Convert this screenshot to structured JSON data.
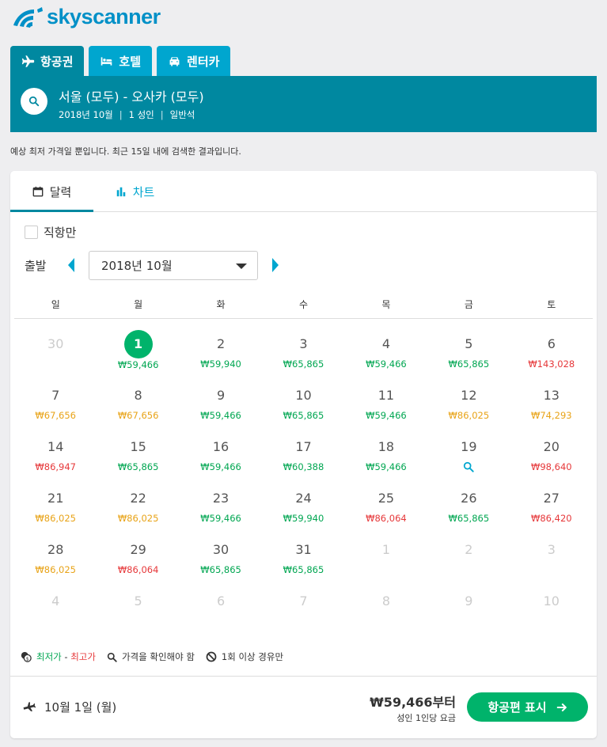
{
  "brand": {
    "name": "skyscanner",
    "color": "#0090c7"
  },
  "tabs": [
    {
      "label": "항공권",
      "icon": "plane-icon",
      "active": true
    },
    {
      "label": "호텔",
      "icon": "bed-icon",
      "active": false
    },
    {
      "label": "렌터카",
      "icon": "car-icon",
      "active": false
    }
  ],
  "search": {
    "route": "서울 (모두) - 오사카 (모두)",
    "month": "2018년 10월",
    "passengers": "1 성인",
    "cabin": "일반석"
  },
  "notice": "예상 최저 가격일 뿐입니다. 최근 15일 내에 검색한 결과입니다.",
  "view_tabs": {
    "calendar": "달력",
    "chart": "차트"
  },
  "direct_only": "직항만",
  "depart_label": "출발",
  "selected_month": "2018년 10월",
  "weekdays": [
    "일",
    "월",
    "화",
    "수",
    "목",
    "금",
    "토"
  ],
  "colors": {
    "cheap": "#00a651",
    "mid": "#e8a317",
    "expensive": "#e6383a",
    "search": "#00a6cf",
    "accent": "#0088a0"
  },
  "days": [
    {
      "num": "30",
      "muted": true
    },
    {
      "num": "1",
      "price": "₩59,466",
      "level": "cheap",
      "selected": true
    },
    {
      "num": "2",
      "price": "₩59,940",
      "level": "cheap"
    },
    {
      "num": "3",
      "price": "₩65,865",
      "level": "cheap"
    },
    {
      "num": "4",
      "price": "₩59,466",
      "level": "cheap"
    },
    {
      "num": "5",
      "price": "₩65,865",
      "level": "cheap"
    },
    {
      "num": "6",
      "price": "₩143,028",
      "level": "expensive"
    },
    {
      "num": "7",
      "price": "₩67,656",
      "level": "mid"
    },
    {
      "num": "8",
      "price": "₩67,656",
      "level": "mid"
    },
    {
      "num": "9",
      "price": "₩59,466",
      "level": "cheap"
    },
    {
      "num": "10",
      "price": "₩65,865",
      "level": "cheap"
    },
    {
      "num": "11",
      "price": "₩59,466",
      "level": "cheap"
    },
    {
      "num": "12",
      "price": "₩86,025",
      "level": "mid"
    },
    {
      "num": "13",
      "price": "₩74,293",
      "level": "mid"
    },
    {
      "num": "14",
      "price": "₩86,947",
      "level": "expensive"
    },
    {
      "num": "15",
      "price": "₩65,865",
      "level": "cheap"
    },
    {
      "num": "16",
      "price": "₩59,466",
      "level": "cheap"
    },
    {
      "num": "17",
      "price": "₩60,388",
      "level": "cheap"
    },
    {
      "num": "18",
      "price": "₩59,466",
      "level": "cheap"
    },
    {
      "num": "19",
      "search": true
    },
    {
      "num": "20",
      "price": "₩98,640",
      "level": "expensive"
    },
    {
      "num": "21",
      "price": "₩86,025",
      "level": "mid"
    },
    {
      "num": "22",
      "price": "₩86,025",
      "level": "mid"
    },
    {
      "num": "23",
      "price": "₩59,466",
      "level": "cheap"
    },
    {
      "num": "24",
      "price": "₩59,940",
      "level": "cheap"
    },
    {
      "num": "25",
      "price": "₩86,064",
      "level": "expensive"
    },
    {
      "num": "26",
      "price": "₩65,865",
      "level": "cheap"
    },
    {
      "num": "27",
      "price": "₩86,420",
      "level": "expensive"
    },
    {
      "num": "28",
      "price": "₩86,025",
      "level": "mid"
    },
    {
      "num": "29",
      "price": "₩86,064",
      "level": "expensive"
    },
    {
      "num": "30",
      "price": "₩65,865",
      "level": "cheap"
    },
    {
      "num": "31",
      "price": "₩65,865",
      "level": "cheap"
    },
    {
      "num": "1",
      "muted": true
    },
    {
      "num": "2",
      "muted": true
    },
    {
      "num": "3",
      "muted": true
    },
    {
      "num": "4",
      "muted": true
    },
    {
      "num": "5",
      "muted": true
    },
    {
      "num": "6",
      "muted": true
    },
    {
      "num": "7",
      "muted": true
    },
    {
      "num": "8",
      "muted": true
    },
    {
      "num": "9",
      "muted": true
    },
    {
      "num": "10",
      "muted": true
    }
  ],
  "legend": {
    "lowest": "최저가",
    "dash": " - ",
    "highest": "최고가",
    "check_price": "가격을 확인해야 함",
    "stops": "1회 이상 경유만"
  },
  "footer": {
    "date": "10월 1일 (월)",
    "price": "₩59,466부터",
    "price_note": "성인 1인당 요금",
    "button": "항공편 표시"
  }
}
